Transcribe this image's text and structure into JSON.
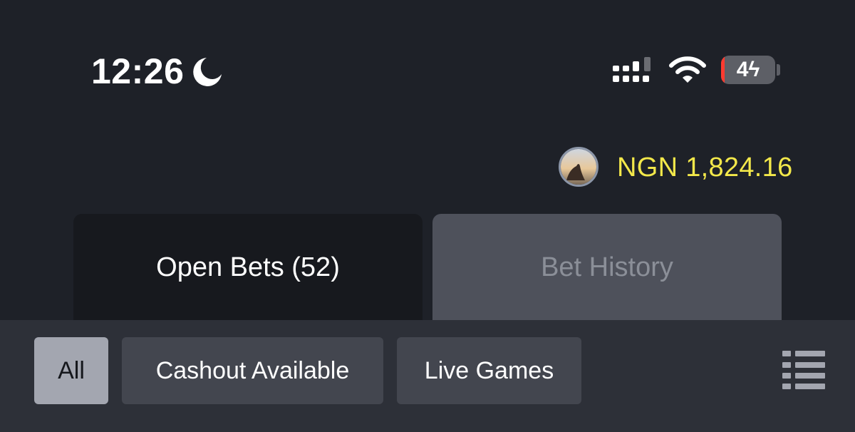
{
  "status_bar": {
    "time": "12:26",
    "focus_icon": "moon-icon",
    "signal_icon": "cellular-signal-icon",
    "wifi_icon": "wifi-icon",
    "battery_level": "4",
    "battery_charging": true,
    "battery_icon": "battery-charging-icon"
  },
  "account": {
    "avatar_icon": "user-avatar",
    "balance": "NGN 1,824.16",
    "balance_color": "#f3e84a"
  },
  "tabs": [
    {
      "label": "Open Bets (52)",
      "active": true
    },
    {
      "label": "Bet History",
      "active": false
    }
  ],
  "filters": [
    {
      "label": "All",
      "selected": true
    },
    {
      "label": "Cashout Available",
      "selected": false
    },
    {
      "label": "Live Games",
      "selected": false
    }
  ],
  "toolbar": {
    "view_toggle_icon": "list-icon"
  }
}
